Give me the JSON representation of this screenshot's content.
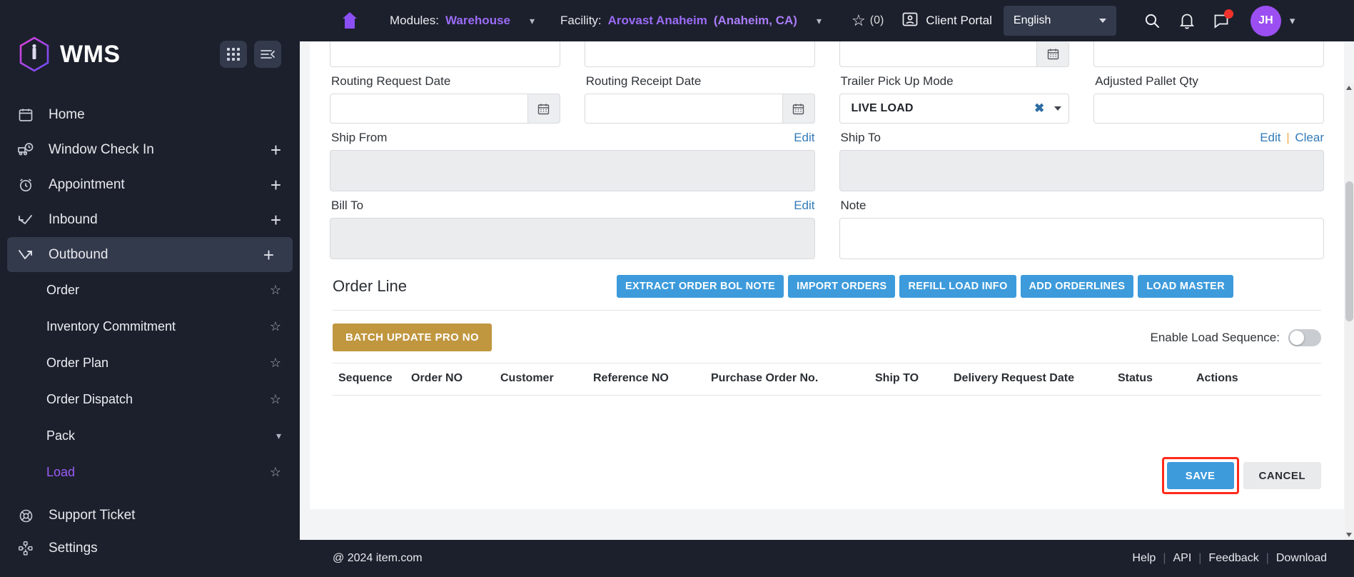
{
  "brand": {
    "name": "WMS",
    "logo_icon": "hexagon-logo-icon"
  },
  "sidebar": {
    "top_buttons": [
      {
        "name": "apps-grid-button",
        "icon": "grid-icon"
      },
      {
        "name": "collapse-sidebar-button",
        "icon": "collapse-menu-icon"
      }
    ],
    "items": [
      {
        "label": "Home",
        "icon": "calendar-icon",
        "has_plus": false,
        "active": false
      },
      {
        "label": "Window Check In",
        "icon": "truck-clock-icon",
        "has_plus": true,
        "active": false
      },
      {
        "label": "Appointment",
        "icon": "alarm-clock-icon",
        "has_plus": true,
        "active": false
      },
      {
        "label": "Inbound",
        "icon": "arrow-inbound-icon",
        "has_plus": true,
        "active": false
      },
      {
        "label": "Outbound",
        "icon": "arrow-outbound-icon",
        "has_plus": true,
        "active": true
      }
    ],
    "sub_items": [
      {
        "label": "Order",
        "trailing": "star",
        "selected": false
      },
      {
        "label": "Inventory Commitment",
        "trailing": "star",
        "selected": false
      },
      {
        "label": "Order Plan",
        "trailing": "star",
        "selected": false
      },
      {
        "label": "Order Dispatch",
        "trailing": "star",
        "selected": false
      },
      {
        "label": "Pack",
        "trailing": "chevron",
        "selected": false
      },
      {
        "label": "Load",
        "trailing": "star",
        "selected": true
      }
    ],
    "bottom_items": [
      {
        "label": "Support Ticket",
        "icon": "lifebuoy-icon"
      },
      {
        "label": "Settings",
        "icon": "settings-nodes-icon"
      }
    ]
  },
  "topbar": {
    "home_icon": "home-icon",
    "modules_label": "Modules:",
    "modules_value": "Warehouse",
    "facility_label": "Facility:",
    "facility_value": "Arovast Anaheim",
    "facility_location": "(Anaheim, CA)",
    "favorites_count": "(0)",
    "client_portal": "Client Portal",
    "language": "English",
    "icons": [
      "search-icon",
      "bell-icon",
      "message-icon"
    ],
    "avatar_initials": "JH"
  },
  "form": {
    "fields": [
      {
        "label": "Routing Request Date",
        "type": "date",
        "value": ""
      },
      {
        "label": "Routing Receipt Date",
        "type": "date",
        "value": ""
      },
      {
        "label": "Trailer Pick Up Mode",
        "type": "select",
        "value": "LIVE LOAD"
      },
      {
        "label": "Adjusted Pallet Qty",
        "type": "text",
        "value": ""
      }
    ],
    "address_blocks": [
      {
        "label": "Ship From",
        "links": [
          "Edit"
        ],
        "value": "",
        "disabled": true
      },
      {
        "label": "Ship To",
        "links": [
          "Edit",
          "Clear"
        ],
        "value": "",
        "disabled": true
      },
      {
        "label": "Bill To",
        "links": [
          "Edit"
        ],
        "value": "",
        "disabled": true
      },
      {
        "label": "Note",
        "links": [],
        "value": "",
        "disabled": false
      }
    ],
    "edit_label": "Edit",
    "clear_label": "Clear",
    "link_separator": "|"
  },
  "order_line": {
    "title": "Order Line",
    "buttons": [
      "EXTRACT ORDER BOL NOTE",
      "IMPORT ORDERS",
      "REFILL LOAD INFO",
      "ADD ORDERLINES",
      "LOAD MASTER"
    ],
    "batch_button": "BATCH UPDATE PRO NO",
    "toggle_label": "Enable Load Sequence:",
    "toggle_on": false,
    "columns": [
      "Sequence",
      "Order NO",
      "Customer",
      "Reference NO",
      "Purchase Order No.",
      "Ship TO",
      "Delivery Request Date",
      "Status",
      "Actions"
    ],
    "rows": []
  },
  "actions": {
    "save": "SAVE",
    "cancel": "CANCEL",
    "save_highlight_color": "#ff2a1a"
  },
  "footer": {
    "copyright": "@ 2024 item.com",
    "links": [
      "Help",
      "API",
      "Feedback",
      "Download"
    ],
    "separator": "|"
  },
  "colors": {
    "sidebar_bg": "#1c202c",
    "accent_purple": "#9b5cf6",
    "primary_blue": "#3d9bdc",
    "gold": "#c0963f",
    "link_blue": "#337ab7"
  }
}
